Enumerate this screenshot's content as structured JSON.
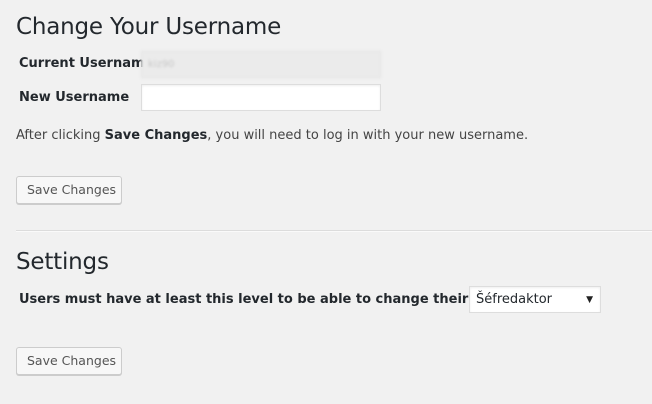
{
  "change_section": {
    "title": "Change Your Username",
    "current_label": "Current Username",
    "current_value": "kiz90",
    "new_label": "New Username",
    "new_value": "",
    "note_prefix": "After clicking ",
    "note_bold": "Save Changes",
    "note_suffix": ", you will need to log in with your new username.",
    "save_label": "Save Changes"
  },
  "settings_section": {
    "title": "Settings",
    "level_label": "Users must have at least this level to be able to change their username",
    "level_selected": "Šéfredaktor",
    "save_label": "Save Changes"
  },
  "icons": {
    "select_arrow": "▼"
  }
}
